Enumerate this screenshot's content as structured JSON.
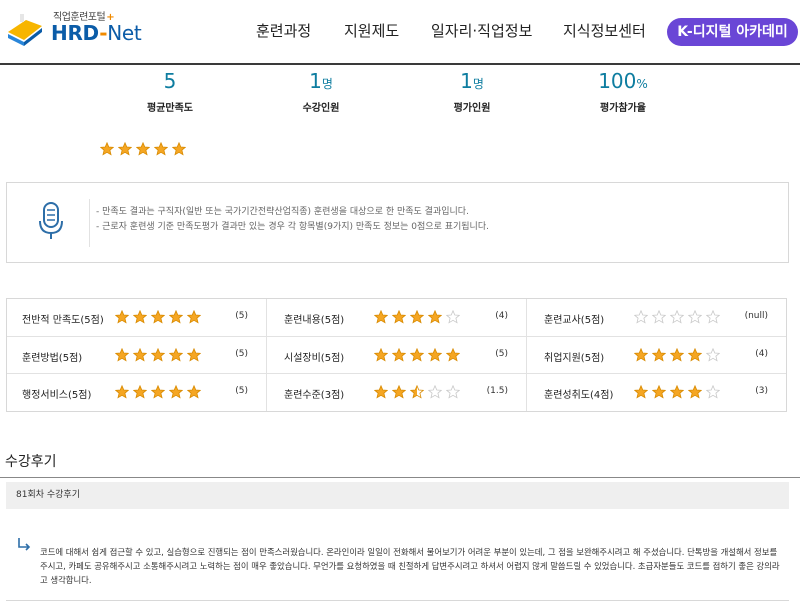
{
  "header": {
    "logo_tagline": "직업훈련포털",
    "logo_plus": "+",
    "logo_hrd": "HRD",
    "logo_dash": "-",
    "logo_net": "Net",
    "nav": [
      "훈련과정",
      "지원제도",
      "일자리·직업정보",
      "지식정보센터"
    ],
    "cta_label": "K-디지털 아카데미",
    "accent_color": "#6a46d6"
  },
  "stats": [
    {
      "value": "5",
      "unit": "",
      "label": "평균만족도"
    },
    {
      "value": "1",
      "unit": "명",
      "label": "수강인원"
    },
    {
      "value": "1",
      "unit": "명",
      "label": "평가인원"
    },
    {
      "value": "100",
      "unit": "%",
      "label": "평가참가율"
    }
  ],
  "overall_rating": 5,
  "notice": {
    "icon": "microphone-icon",
    "lines": [
      "- 만족도 결과는 구직자(일반 또는 국가기간전략산업직종) 훈련생을 대상으로 한 만족도 결과입니다.",
      "- 근로자 훈련생 기준 만족도평가 결과만 있는 경우 각 항목별(9가지) 만족도 정보는 0점으로 표기됩니다."
    ]
  },
  "ratings": [
    {
      "label": "전반적 만족도(5점)",
      "stars": 5,
      "max": 5,
      "score": "(5)"
    },
    {
      "label": "훈련내용(5점)",
      "stars": 4,
      "max": 5,
      "score": "(4)"
    },
    {
      "label": "훈련교사(5점)",
      "stars": 0,
      "max": 5,
      "score": "(null)"
    },
    {
      "label": "훈련방법(5점)",
      "stars": 5,
      "max": 5,
      "score": "(5)"
    },
    {
      "label": "시설장비(5점)",
      "stars": 5,
      "max": 5,
      "score": "(5)"
    },
    {
      "label": "취업지원(5점)",
      "stars": 4,
      "max": 5,
      "score": "(4)"
    },
    {
      "label": "행정서비스(5점)",
      "stars": 5,
      "max": 5,
      "score": "(5)"
    },
    {
      "label": "훈련수준(3점)",
      "stars": 2.5,
      "max": 5,
      "score": "(1.5)"
    },
    {
      "label": "훈련성취도(4점)",
      "stars": 4,
      "max": 5,
      "score": "(3)"
    }
  ],
  "review": {
    "section_title": "수강후기",
    "session_label": "81회차 수강후기",
    "text": "코드에 대해서 쉽게 접근할 수 있고, 실습형으로 진행되는 점이 만족스러웠습니다. 온라인이라 일일이 전화해서 물어보기가 어려운 부분이 있는데, 그 점을 보완해주시려고 해 주셨습니다. 단톡방을 개설해서 정보를 주시고, 카페도 공유해주시고 소통해주시려고 노력하는 점이 매우 좋았습니다. 무언가를 요청하였을 때 친절하게 답변주시려고 하셔서 어렵지 않게 말씀드릴 수 있었습니다. 초급자분들도 코드를 접하기 좋은 강의라고 생각합니다."
  },
  "colors": {
    "star_fill": "#f5a623",
    "star_empty": "#c8c8c8",
    "stat_value": "#0e7da0"
  }
}
